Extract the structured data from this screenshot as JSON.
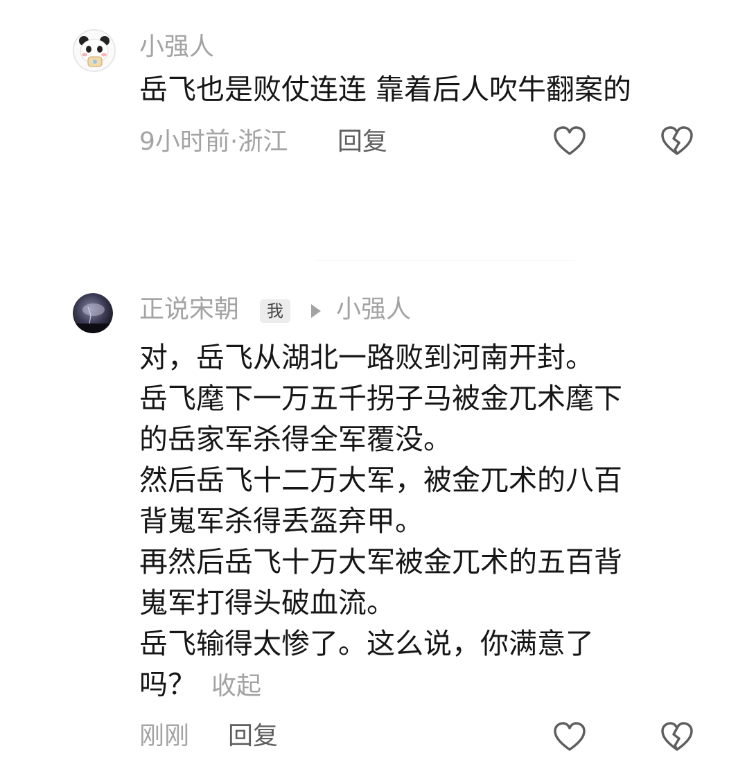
{
  "comments": [
    {
      "username": "小强人",
      "text": "岳飞也是败仗连连 靠着后人吹牛翻案的",
      "time_location": "9小时前·浙江",
      "reply_label": "回复",
      "avatar_icon": "panda-avatar"
    },
    {
      "username": "正说宋朝",
      "me_badge": "我",
      "reply_to": "小强人",
      "lines": [
        "对，岳飞从湖北一路败到河南开封。",
        "岳飞麾下一万五千拐子马被金兀术麾下",
        "的岳家军杀得全军覆没。",
        "然后岳飞十二万大军，被金兀术的八百",
        "背嵬军杀得丢盔弃甲。",
        "再然后岳飞十万大军被金兀术的五百背",
        "嵬军打得头破血流。",
        "岳飞输得太惨了。这么说，你满意了",
        "吗？"
      ],
      "collapse_label": "收起",
      "time": "刚刚",
      "reply_label": "回复",
      "avatar_icon": "night-sky-avatar"
    }
  ],
  "icons": {
    "like": "heart-icon",
    "dislike": "broken-heart-icon"
  },
  "colors": {
    "text": "#161616",
    "muted": "#a3a3a3",
    "reply": "#5e5e5e",
    "badge_bg": "#ececec"
  }
}
